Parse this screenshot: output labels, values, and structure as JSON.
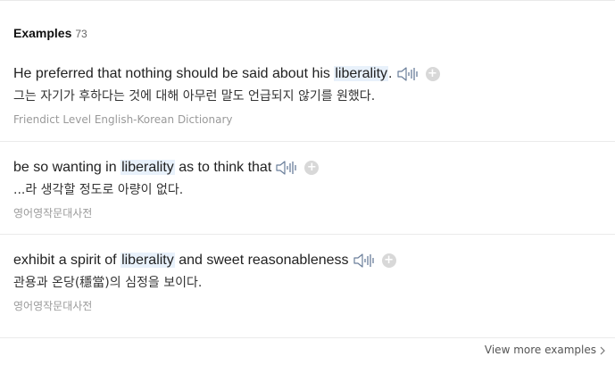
{
  "header": {
    "title": "Examples",
    "count": "73"
  },
  "examples": [
    {
      "pre": "He preferred that nothing should be said about his ",
      "highlight": "liberality",
      "post": ".",
      "translation": "그는 자기가 후하다는 것에 대해 아무런 말도 언급되지 않기를 원했다.",
      "source": "Friendict Level English-Korean Dictionary"
    },
    {
      "pre": "be so wanting in ",
      "highlight": "liberality",
      "post": " as to think that",
      "translation": "...라 생각할 정도로 아량이 없다.",
      "source": "영어영작문대사전"
    },
    {
      "pre": "exhibit a spirit of ",
      "highlight": "liberality",
      "post": " and sweet reasonableness",
      "translation": "관용과 온당(穩當)의 심정을 보이다.",
      "source": "영어영작문대사전"
    }
  ],
  "footer": {
    "view_more_label": "View more examples"
  },
  "icons": {
    "speaker": "speaker-icon",
    "add": "plus-circle-icon",
    "chevron": "chevron-right-icon"
  },
  "colors": {
    "highlight": "#e8f1fb",
    "speaker_stroke": "#6a7e9a",
    "add_button": "#d8d8d8"
  }
}
